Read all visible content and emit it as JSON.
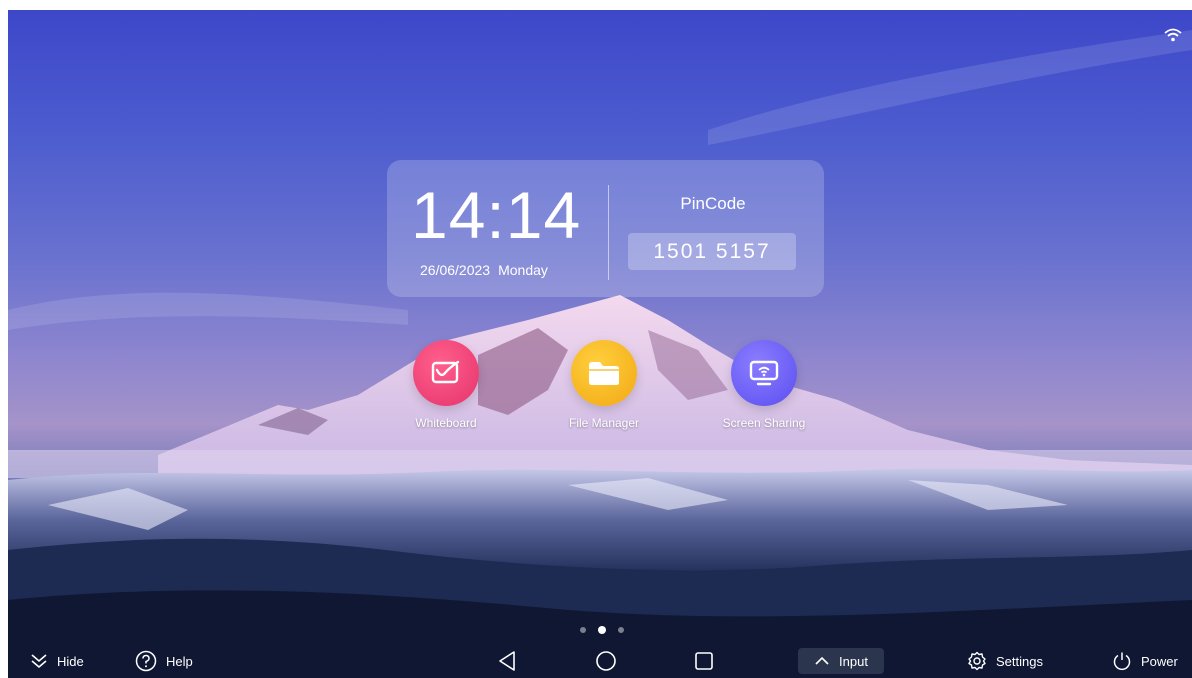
{
  "clock": {
    "time": "14:14",
    "date": "26/06/2023",
    "day": "Monday"
  },
  "pin": {
    "label": "PinCode",
    "code": "1501 5157"
  },
  "apps": [
    {
      "label": "Whiteboard",
      "icon": "whiteboard-icon",
      "color": "#e5336c"
    },
    {
      "label": "File Manager",
      "icon": "folder-icon",
      "color": "#f2a814"
    },
    {
      "label": "Screen Sharing",
      "icon": "screen-cast-icon",
      "color": "#5a4ef0"
    }
  ],
  "pager": {
    "pages": 3,
    "active": 2
  },
  "bottom_bar": {
    "hide_label": "Hide",
    "help_label": "Help",
    "input_label": "Input",
    "settings_label": "Settings",
    "power_label": "Power"
  },
  "status": {
    "icon": "wifi-icon"
  }
}
